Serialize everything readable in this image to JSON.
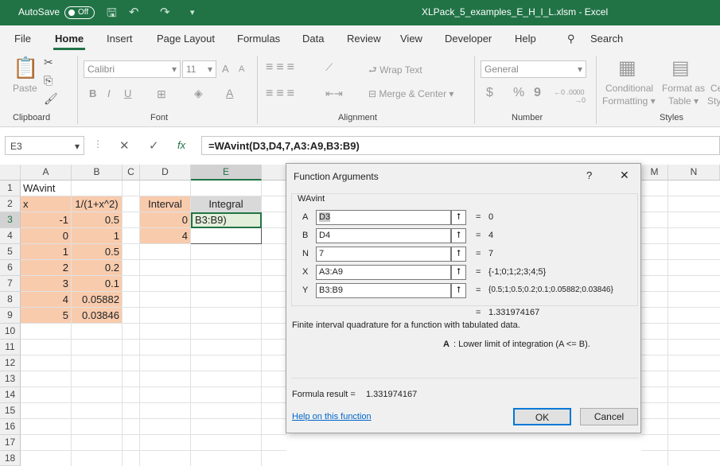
{
  "titlebar": {
    "autosave_label": "AutoSave",
    "autosave_state": "Off",
    "window_title": "XLPack_5_examples_E_H_I_L.xlsm  -  Excel"
  },
  "menu": [
    "File",
    "Home",
    "Insert",
    "Page Layout",
    "Formulas",
    "Data",
    "Review",
    "View",
    "Developer",
    "Help"
  ],
  "search_label": "Search",
  "ribbon": {
    "clipboard": {
      "paste": "Paste",
      "group": "Clipboard"
    },
    "font": {
      "name": "Calibri",
      "size": "11",
      "grow": "A",
      "shrink": "A",
      "bold": "B",
      "italic": "I",
      "underline": "U",
      "group": "Font"
    },
    "alignment": {
      "wrap": "Wrap Text",
      "merge": "Merge & Center",
      "group": "Alignment"
    },
    "number": {
      "format": "General",
      "currency": "$",
      "percent": "%",
      "comma": "9",
      "dec_inc": "←0 .00",
      "dec_dec": ".00 →0",
      "group": "Number"
    },
    "styles": {
      "cond1": "Conditional",
      "cond2": "Formatting",
      "fmt1": "Format as",
      "fmt2": "Table",
      "cell1": "Ce",
      "cell2": "Sty",
      "group": "Styles"
    }
  },
  "formula_bar": {
    "namebox": "E3",
    "cancel": "✕",
    "enter": "✓",
    "fx": "fx",
    "formula": "=WAvint(D3,D4,7,A3:A9,B3:B9)"
  },
  "columns": [
    "A",
    "B",
    "C",
    "D",
    "E",
    "M",
    "N"
  ],
  "rows": [
    "1",
    "2",
    "3",
    "4",
    "5",
    "6",
    "7",
    "8",
    "9",
    "10",
    "11",
    "12",
    "13",
    "14",
    "15",
    "16",
    "17",
    "18"
  ],
  "cells": {
    "A1": "WAvint",
    "A2": "x",
    "B2": "1/(1+x^2)",
    "D2": "Interval",
    "E2": "Integral",
    "A3": "-1",
    "B3": "0.5",
    "D3": "0",
    "E3": "B3:B9)",
    "A4": "0",
    "B4": "1",
    "D4": "4",
    "A5": "1",
    "B5": "0.5",
    "A6": "2",
    "B6": "0.2",
    "A7": "3",
    "B7": "0.1",
    "A8": "4",
    "B8": "0.05882",
    "A9": "5",
    "B9": "0.03846"
  },
  "dialog": {
    "title": "Function Arguments",
    "help_glyph": "?",
    "close_glyph": "✕",
    "function_name": "WAvint",
    "args": [
      {
        "name": "A",
        "input": "D3",
        "value": "0"
      },
      {
        "name": "B",
        "input": "D4",
        "value": "4"
      },
      {
        "name": "N",
        "input": "7",
        "value": "7"
      },
      {
        "name": "X",
        "input": "A3:A9",
        "value": "{-1;0;1;2;3;4;5}"
      },
      {
        "name": "Y",
        "input": "B3:B9",
        "value": "{0.5;1;0.5;0.2;0.1;0.05882;0.03846}"
      }
    ],
    "eq": "=",
    "collapse_glyph": "⭡",
    "result_preview": "1.331974167",
    "description": "Finite interval quadrature for a function with tabulated data.",
    "arg_help_name": "A",
    "arg_help_text": ":  Lower limit of integration (A <= B).",
    "formula_result_label": "Formula result =",
    "formula_result_value": "1.331974167",
    "help_link": "Help on this function",
    "ok": "OK",
    "cancel": "Cancel"
  }
}
